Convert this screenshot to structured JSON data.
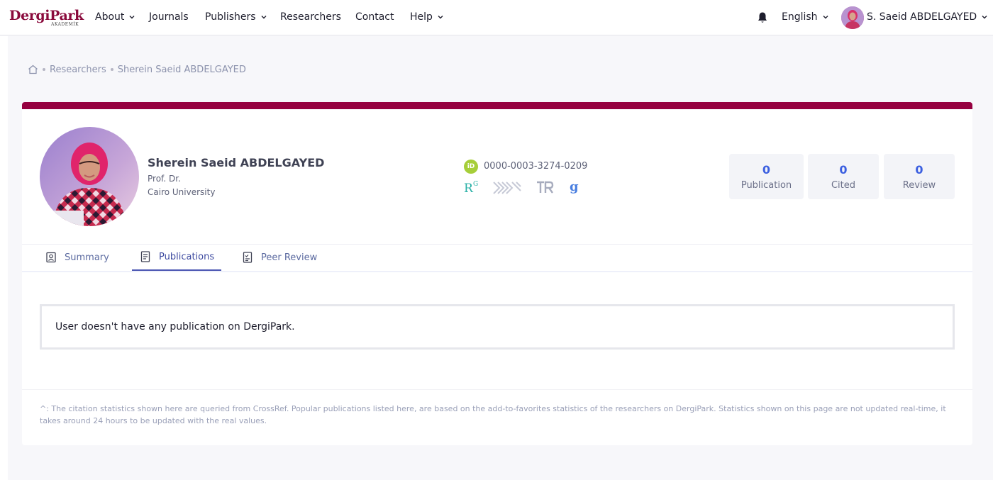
{
  "nav": {
    "logo_main": "DergiPark",
    "logo_sub": "AKADEMİK",
    "items": [
      {
        "label": "About",
        "has_dropdown": true
      },
      {
        "label": "Journals",
        "has_dropdown": false
      },
      {
        "label": "Publishers",
        "has_dropdown": true
      },
      {
        "label": "Researchers",
        "has_dropdown": false
      },
      {
        "label": "Contact",
        "has_dropdown": false
      },
      {
        "label": "Help",
        "has_dropdown": true
      }
    ],
    "notifications_icon": "bell-icon",
    "language": "English",
    "user_name": "S. Saeid ABDELGAYED"
  },
  "breadcrumb": {
    "home_icon": "home-icon",
    "items": [
      "Researchers",
      "Sherein Saeid ABDELGAYED"
    ]
  },
  "profile": {
    "accent_color": "#960040",
    "name": "Sherein Saeid ABDELGAYED",
    "title": "Prof. Dr.",
    "affiliation": "Cairo University",
    "orcid": "0000-0003-3274-0209",
    "scholar_icons": [
      "researchgate-icon",
      "yok-academic-icon",
      "trdizin-icon",
      "google-scholar-icon"
    ],
    "stats": [
      {
        "value": "0",
        "label": "Publication"
      },
      {
        "value": "0",
        "label": "Cited"
      },
      {
        "value": "0",
        "label": "Review"
      }
    ]
  },
  "tabs": [
    {
      "label": "Summary",
      "active": false
    },
    {
      "label": "Publications",
      "active": true
    },
    {
      "label": "Peer Review",
      "active": false
    }
  ],
  "content": {
    "empty_message": "User doesn't have any publication on DergiPark."
  },
  "footnote": "^: The citation statistics shown here are queried from CrossRef. Popular publications listed here, are based on the add-to-favorites statistics of the researchers on DergiPark. Statistics shown on this page are not updated real-time, it takes around 24 hours to be updated with the real values."
}
